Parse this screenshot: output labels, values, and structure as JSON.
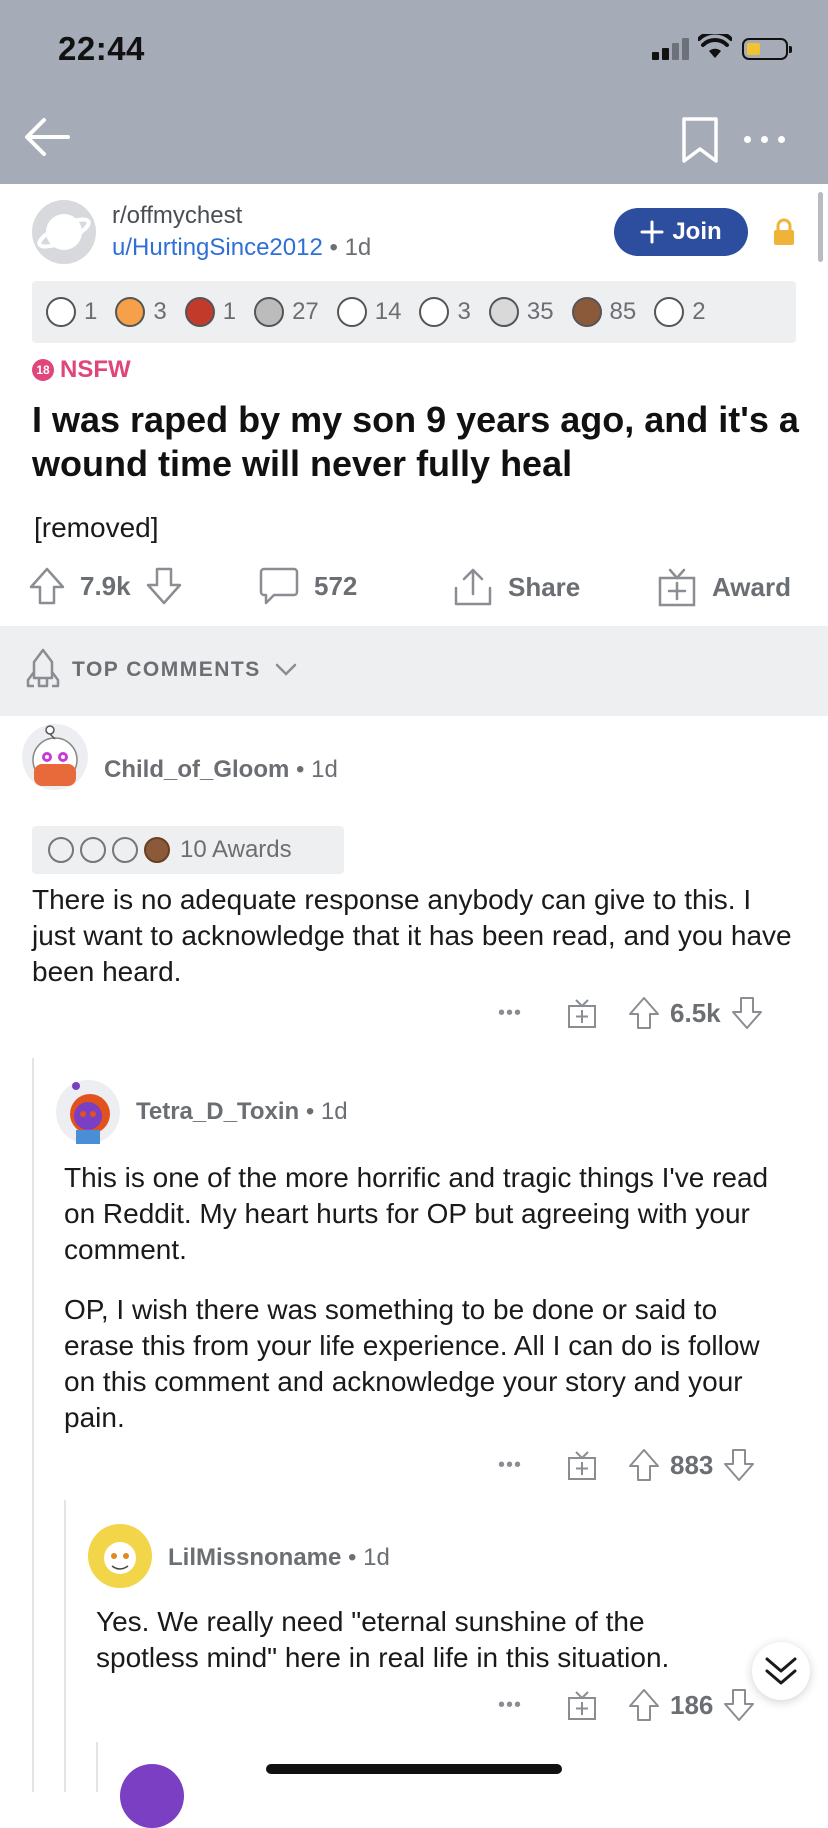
{
  "status_bar": {
    "time": "22:44"
  },
  "subreddit": {
    "name": "r/offmychest",
    "author": "u/HurtingSince2012",
    "age": "1d",
    "join_label": "Join"
  },
  "awards": [
    {
      "icon": "wholesome-seal-icon",
      "count": "1"
    },
    {
      "icon": "starstruck-icon",
      "count": "3"
    },
    {
      "icon": "gift-icon",
      "count": "1"
    },
    {
      "icon": "hugz-icon",
      "count": "27"
    },
    {
      "icon": "wholesome-icon",
      "count": "14"
    },
    {
      "icon": "heartwarming-icon",
      "count": "3"
    },
    {
      "icon": "silver-icon",
      "count": "35"
    },
    {
      "icon": "bear-hug-icon",
      "count": "85"
    },
    {
      "icon": "seal-icon",
      "count": "2"
    }
  ],
  "post": {
    "nsfw_badge": "18",
    "nsfw_label": "NSFW",
    "title": "I was raped by my son 9 years ago, and it's a wound time will never fully heal",
    "body": "[removed]",
    "upvotes": "7.9k",
    "comments": "572",
    "share_label": "Share",
    "award_label": "Award"
  },
  "sort": {
    "label": "TOP COMMENTS"
  },
  "comments": [
    {
      "user": "Child_of_Gloom",
      "age": "1d",
      "awards_label": "10 Awards",
      "text": "There is no adequate response anybody can give to this. I just want to acknowledge that it has been read, and you have been heard.",
      "score": "6.5k"
    },
    {
      "user": "Tetra_D_Toxin",
      "age": "1d",
      "text1": "This is one of the more horrific and tragic things I've read on Reddit. My heart hurts  for OP but agreeing with your comment.",
      "text2": "OP, I wish there was something to be done or said to erase this from your life experience. All I can do is follow on this comment and acknowledge your story and your pain.",
      "score": "883"
    },
    {
      "user": "LilMissnoname",
      "age": "1d",
      "text": "Yes. We really need \"eternal sunshine of the spotless mind\" here in real life in this situation.",
      "score": "186"
    }
  ],
  "more_label": "•••",
  "colors": {
    "header": "#a6abb8",
    "join": "#2d4d9e",
    "nsfw": "#e0457b",
    "link": "#2f6fd6",
    "lock": "#f0b33a"
  }
}
